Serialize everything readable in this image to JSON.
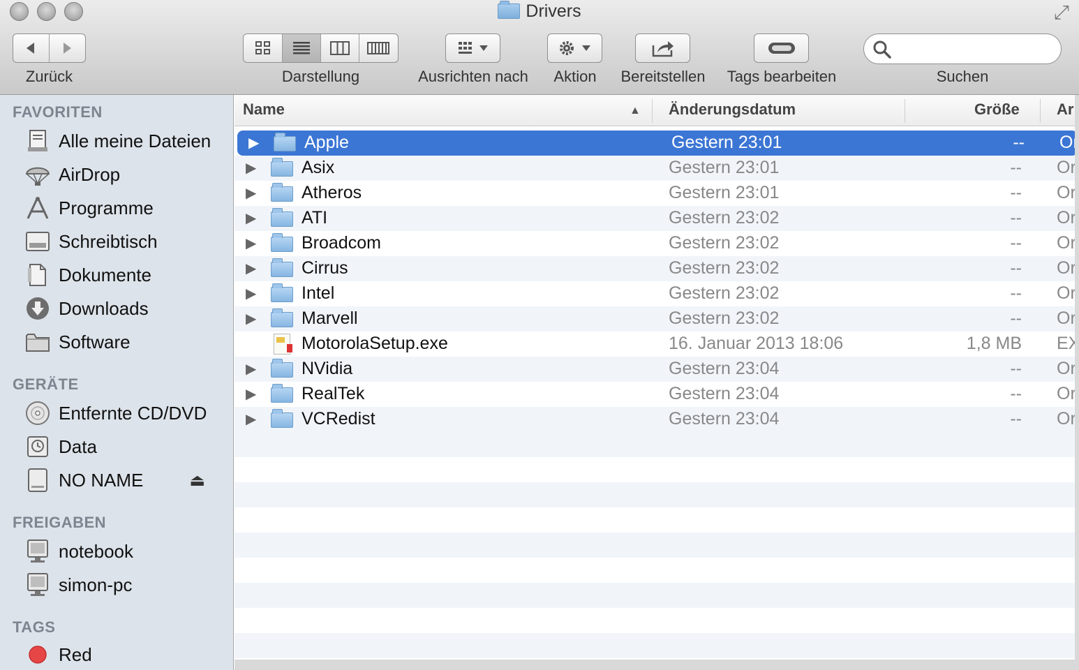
{
  "window": {
    "title": "Drivers"
  },
  "toolbar": {
    "back_label": "Zurück",
    "view_label": "Darstellung",
    "arrange_label": "Ausrichten nach",
    "action_label": "Aktion",
    "share_label": "Bereitstellen",
    "tags_label": "Tags bearbeiten",
    "search_label": "Suchen",
    "search_value": "",
    "active_view": "list"
  },
  "sidebar": {
    "favorites_heading": "FAVORITEN",
    "favorites": [
      {
        "label": "Alle meine Dateien",
        "icon": "all-files-icon"
      },
      {
        "label": "AirDrop",
        "icon": "airdrop-icon"
      },
      {
        "label": "Programme",
        "icon": "applications-icon"
      },
      {
        "label": "Schreibtisch",
        "icon": "desktop-icon"
      },
      {
        "label": "Dokumente",
        "icon": "documents-icon"
      },
      {
        "label": "Downloads",
        "icon": "downloads-icon"
      },
      {
        "label": "Software",
        "icon": "folder-icon"
      }
    ],
    "devices_heading": "GERÄTE",
    "devices": [
      {
        "label": "Entfernte CD/DVD",
        "icon": "cd-dvd-icon"
      },
      {
        "label": "Data",
        "icon": "timemachine-drive-icon"
      },
      {
        "label": "NO NAME",
        "icon": "drive-icon"
      }
    ],
    "shared_heading": "FREIGABEN",
    "shared": [
      {
        "label": "notebook",
        "icon": "computer-icon"
      },
      {
        "label": "simon-pc",
        "icon": "computer-icon"
      }
    ],
    "tags_heading": "TAGS",
    "tags": [
      {
        "label": "Red",
        "color": "#e64646"
      }
    ]
  },
  "list": {
    "columns": {
      "name": "Name",
      "date": "Änderungsdatum",
      "size": "Größe",
      "kind": "Ar"
    },
    "sort": {
      "column": "name",
      "direction": "ascending"
    },
    "rows": [
      {
        "name": "Apple",
        "date": "Gestern 23:01",
        "size": "--",
        "kind": "Or",
        "type": "folder",
        "selected": true
      },
      {
        "name": "Asix",
        "date": "Gestern 23:01",
        "size": "--",
        "kind": "Or",
        "type": "folder"
      },
      {
        "name": "Atheros",
        "date": "Gestern 23:01",
        "size": "--",
        "kind": "Or",
        "type": "folder"
      },
      {
        "name": "ATI",
        "date": "Gestern 23:02",
        "size": "--",
        "kind": "Or",
        "type": "folder"
      },
      {
        "name": "Broadcom",
        "date": "Gestern 23:02",
        "size": "--",
        "kind": "Or",
        "type": "folder"
      },
      {
        "name": "Cirrus",
        "date": "Gestern 23:02",
        "size": "--",
        "kind": "Or",
        "type": "folder"
      },
      {
        "name": "Intel",
        "date": "Gestern 23:02",
        "size": "--",
        "kind": "Or",
        "type": "folder"
      },
      {
        "name": "Marvell",
        "date": "Gestern 23:02",
        "size": "--",
        "kind": "Or",
        "type": "folder"
      },
      {
        "name": "MotorolaSetup.exe",
        "date": "16. Januar 2013 18:06",
        "size": "1,8 MB",
        "kind": "EX",
        "type": "file"
      },
      {
        "name": "NVidia",
        "date": "Gestern 23:04",
        "size": "--",
        "kind": "Or",
        "type": "folder"
      },
      {
        "name": "RealTek",
        "date": "Gestern 23:04",
        "size": "--",
        "kind": "Or",
        "type": "folder"
      },
      {
        "name": "VCRedist",
        "date": "Gestern 23:04",
        "size": "--",
        "kind": "Or",
        "type": "folder"
      }
    ]
  },
  "colors": {
    "selection": "#3c76d4",
    "sidebar_bg": "#dde3ea",
    "row_stripe": "#f1f5fa",
    "folder_blue": "#86b6e2"
  }
}
